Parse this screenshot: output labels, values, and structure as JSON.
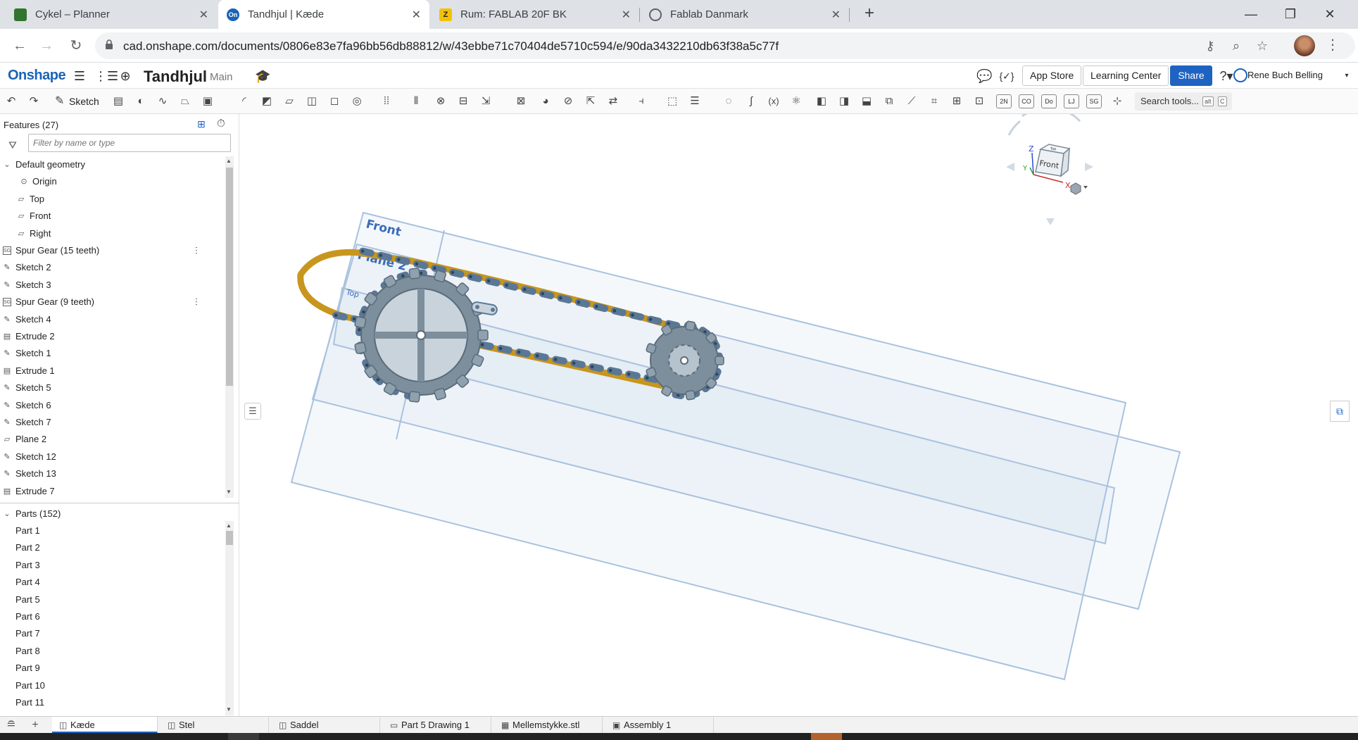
{
  "browser": {
    "tabs": [
      {
        "title": "Cykel – Planner",
        "icon_color": "#31752f",
        "icon_letter": ""
      },
      {
        "title": "Tandhjul | Kæde",
        "icon_color": "#1a63b7",
        "icon_letter": "On"
      },
      {
        "title": "Rum: FABLAB 20F BK",
        "icon_color": "#f2c200",
        "icon_letter": "Z"
      },
      {
        "title": "Fablab Danmark",
        "icon_color": "#5f6368",
        "icon_letter": ""
      }
    ],
    "url": "cad.onshape.com/documents/0806e83e7fa96bb56db88812/w/43ebbe71c70404de5710c594/e/90da3432210db63f38a5c77f"
  },
  "header": {
    "logo": "Onshape",
    "doc_title": "Tandhjul",
    "workspace": "Main",
    "app_store": "App Store",
    "learning_center": "Learning Center",
    "share": "Share",
    "user": "Rene Buch Belling"
  },
  "toolbar": {
    "sketch": "Sketch",
    "search_tools": "Search tools...",
    "search_shortcut_1": "alt",
    "search_shortcut_2": "C",
    "text_tools": [
      "2N",
      "CO",
      "Do",
      "LJ",
      "SG"
    ]
  },
  "features": {
    "title": "Features (27)",
    "filter_placeholder": "Filter by name or type",
    "items": [
      {
        "label": "Default geometry",
        "icon": "chevron-down-icon",
        "level": 0
      },
      {
        "label": "Origin",
        "icon": "origin-icon",
        "level": 2
      },
      {
        "label": "Top",
        "icon": "plane-icon",
        "level": 1
      },
      {
        "label": "Front",
        "icon": "plane-icon",
        "level": 1
      },
      {
        "label": "Right",
        "icon": "plane-icon",
        "level": 1
      },
      {
        "label": "Spur Gear (15 teeth)",
        "icon": "feature-studio-icon",
        "level": 0,
        "menu": true
      },
      {
        "label": "Sketch 2",
        "icon": "sketch-icon",
        "level": 0
      },
      {
        "label": "Sketch 3",
        "icon": "sketch-icon",
        "level": 0
      },
      {
        "label": "Spur Gear (9 teeth)",
        "icon": "feature-studio-icon",
        "level": 0,
        "menu": true
      },
      {
        "label": "Sketch 4",
        "icon": "sketch-icon",
        "level": 0
      },
      {
        "label": "Extrude 2",
        "icon": "extrude-icon",
        "level": 0
      },
      {
        "label": "Sketch 1",
        "icon": "sketch-icon",
        "level": 0
      },
      {
        "label": "Extrude 1",
        "icon": "extrude-icon",
        "level": 0
      },
      {
        "label": "Sketch 5",
        "icon": "sketch-icon",
        "level": 0
      },
      {
        "label": "Sketch 6",
        "icon": "sketch-icon",
        "level": 0
      },
      {
        "label": "Sketch 7",
        "icon": "sketch-icon",
        "level": 0
      },
      {
        "label": "Plane 2",
        "icon": "plane-icon",
        "level": 0
      },
      {
        "label": "Sketch 12",
        "icon": "sketch-icon",
        "level": 0
      },
      {
        "label": "Sketch 13",
        "icon": "sketch-icon",
        "level": 0
      },
      {
        "label": "Extrude 7",
        "icon": "extrude-icon",
        "level": 0
      }
    ]
  },
  "parts": {
    "title": "Parts (152)",
    "items": [
      "Part 1",
      "Part 2",
      "Part 3",
      "Part 4",
      "Part 5",
      "Part 6",
      "Part 7",
      "Part 8",
      "Part 9",
      "Part 10",
      "Part 11"
    ]
  },
  "viewport": {
    "plane_labels": [
      "Front",
      "Plane 2",
      "Top"
    ],
    "view_cube": {
      "face": "Front",
      "top_face": "Top",
      "axis_z": "Z",
      "axis_x": "X",
      "axis_y": "Y"
    },
    "chain_color": "#c8961e",
    "link_color": "#5a7896",
    "gear_color": "#8fa0ae",
    "plane_color": "#a9c2de"
  },
  "bottom_tabs": [
    {
      "label": "Kæde",
      "icon": "part-studio-icon",
      "active": true
    },
    {
      "label": "Stel",
      "icon": "part-studio-icon"
    },
    {
      "label": "Saddel",
      "icon": "part-studio-icon"
    },
    {
      "label": "Part 5 Drawing 1",
      "icon": "drawing-icon"
    },
    {
      "label": "Mellemstykke.stl",
      "icon": "stl-icon"
    },
    {
      "label": "Assembly 1",
      "icon": "assembly-icon"
    }
  ]
}
